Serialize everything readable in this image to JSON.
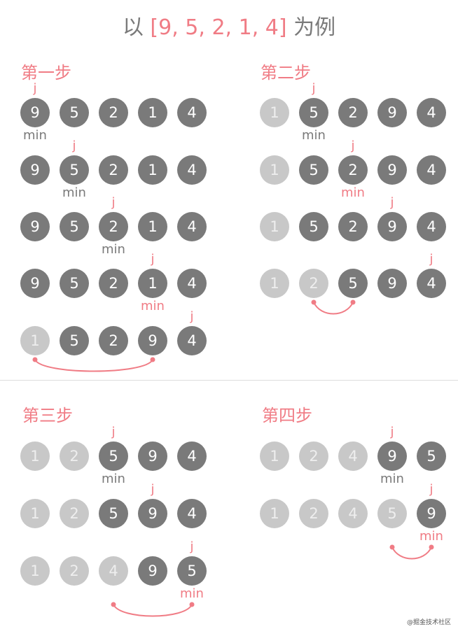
{
  "title": {
    "prefix": "以 ",
    "highlight": "[9, 5, 2, 1, 4]",
    "suffix": " 为例"
  },
  "labels": {
    "j": "j",
    "min": "min"
  },
  "colors": {
    "accent": "#f07c85",
    "active": "#7a7a7a",
    "done": "#c8c8c8"
  },
  "steps": [
    {
      "label": "第一步",
      "rows": [
        {
          "values": [
            "9",
            "5",
            "2",
            "1",
            "4"
          ],
          "done": 0,
          "j": 0,
          "min": 0,
          "minColor": "gray"
        },
        {
          "values": [
            "9",
            "5",
            "2",
            "1",
            "4"
          ],
          "done": 0,
          "j": 1,
          "min": 1,
          "minColor": "gray"
        },
        {
          "values": [
            "9",
            "5",
            "2",
            "1",
            "4"
          ],
          "done": 0,
          "j": 2,
          "min": 2,
          "minColor": "gray"
        },
        {
          "values": [
            "9",
            "5",
            "2",
            "1",
            "4"
          ],
          "done": 0,
          "j": 3,
          "min": 3,
          "minColor": "pink"
        },
        {
          "values": [
            "1",
            "5",
            "2",
            "9",
            "4"
          ],
          "done": 1,
          "j": 4,
          "swap": [
            0,
            3
          ]
        }
      ]
    },
    {
      "label": "第二步",
      "rows": [
        {
          "values": [
            "1",
            "5",
            "2",
            "9",
            "4"
          ],
          "done": 1,
          "j": 1,
          "min": 1,
          "minColor": "gray"
        },
        {
          "values": [
            "1",
            "5",
            "2",
            "9",
            "4"
          ],
          "done": 1,
          "j": 2,
          "min": 2,
          "minColor": "pink"
        },
        {
          "values": [
            "1",
            "5",
            "2",
            "9",
            "4"
          ],
          "done": 1,
          "j": 3
        },
        {
          "values": [
            "1",
            "2",
            "5",
            "9",
            "4"
          ],
          "done": 2,
          "j": 4,
          "swap": [
            1,
            2
          ]
        }
      ]
    },
    {
      "label": "第三步",
      "rows": [
        {
          "values": [
            "1",
            "2",
            "5",
            "9",
            "4"
          ],
          "done": 2,
          "j": 2,
          "min": 2,
          "minColor": "gray"
        },
        {
          "values": [
            "1",
            "2",
            "5",
            "9",
            "4"
          ],
          "done": 2,
          "j": 3
        },
        {
          "values": [
            "1",
            "2",
            "4",
            "9",
            "5"
          ],
          "done": 3,
          "j": 4,
          "min": 4,
          "minColor": "pink",
          "swap": [
            2,
            4
          ]
        }
      ]
    },
    {
      "label": "第四步",
      "rows": [
        {
          "values": [
            "1",
            "2",
            "4",
            "9",
            "5"
          ],
          "done": 3,
          "j": 3,
          "min": 3,
          "minColor": "gray"
        },
        {
          "values": [
            "1",
            "2",
            "4",
            "5",
            "9"
          ],
          "done": 4,
          "j": 4,
          "min": 4,
          "minColor": "pink",
          "swap": [
            3,
            4
          ]
        }
      ]
    }
  ],
  "watermark": "@掘金技术社区"
}
